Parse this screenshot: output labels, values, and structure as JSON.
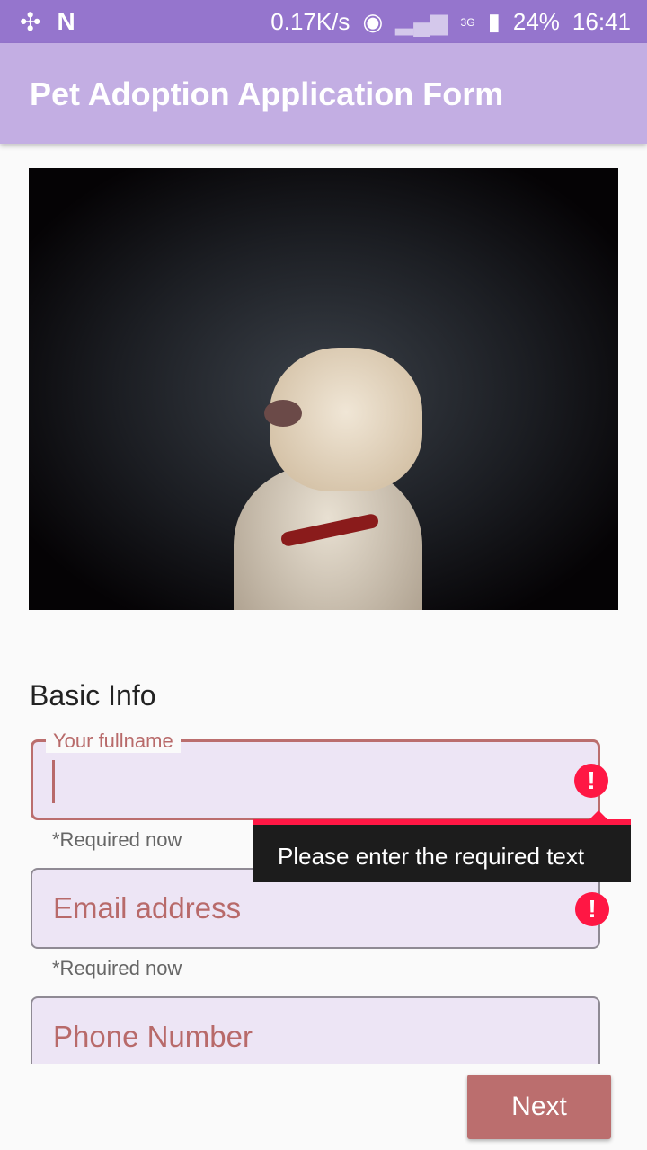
{
  "status_bar": {
    "speed": "0.17K/s",
    "network": "3G",
    "battery": "24%",
    "time": "16:41"
  },
  "app_bar": {
    "title": "Pet Adoption Application Form"
  },
  "form": {
    "section_title": "Basic Info",
    "fullname": {
      "label": "Your fullname",
      "value": "",
      "helper": "*Required now",
      "error": "Please enter the required text"
    },
    "email": {
      "placeholder": "Email address",
      "helper": "*Required now"
    },
    "phone": {
      "placeholder": "Phone Number"
    }
  },
  "next_button": "Next",
  "colors": {
    "status_bar": "#9575cd",
    "app_bar": "#c3aee3",
    "accent": "#bb6e6e",
    "error": "#ff1744",
    "field_bg": "#ede5f5"
  }
}
